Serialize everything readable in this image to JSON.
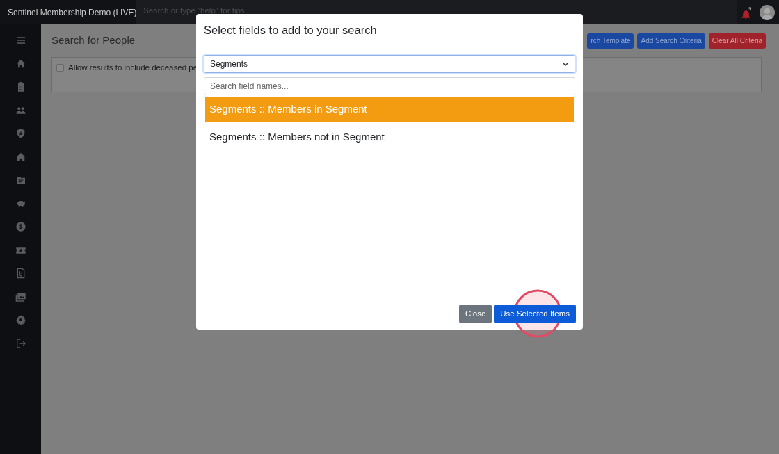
{
  "app": {
    "title": "Sentinel Membership Demo (LIVE)",
    "search_placeholder": "Search or type \"help\" for tips",
    "notification_count": "9"
  },
  "page": {
    "title": "Search for People",
    "buttons": [
      {
        "label": "rch Template",
        "kind": "primary"
      },
      {
        "label": "Add Search Criteria",
        "kind": "primary"
      },
      {
        "label": "Clear All Criteria",
        "kind": "danger"
      }
    ],
    "options": [
      {
        "label": "Allow results to include deceased pe",
        "checked": false
      }
    ]
  },
  "modal": {
    "title": "Select fields to add to your search",
    "category": "Segments",
    "search_placeholder": "Search field names...",
    "fields": [
      {
        "label": "Segments :: Members in Segment",
        "selected": true
      },
      {
        "label": "Segments :: Members not in Segment",
        "selected": false
      }
    ],
    "buttons": [
      {
        "label": "Close",
        "kind": "secondary"
      },
      {
        "label": "Use Selected Items",
        "kind": "primary"
      }
    ]
  }
}
